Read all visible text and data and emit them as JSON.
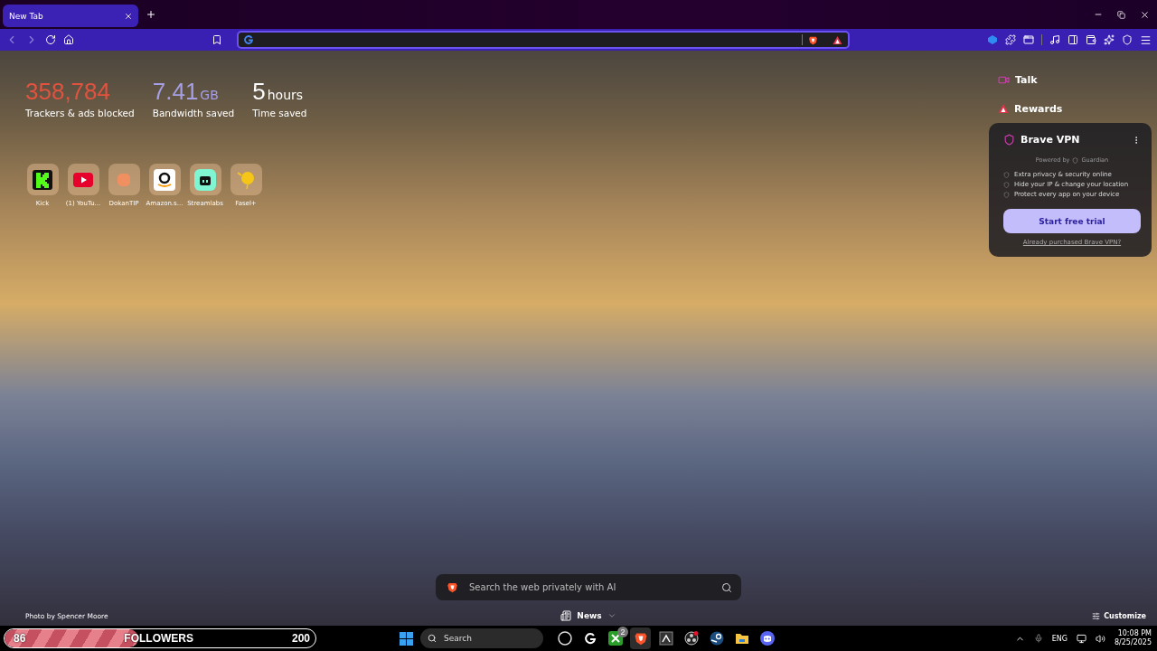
{
  "tabs": [
    {
      "title": "New Tab",
      "selected": true
    }
  ],
  "nav_buttons": [
    {
      "kind": "back",
      "disabled": true
    },
    {
      "kind": "forward",
      "disabled": true
    },
    {
      "kind": "reload",
      "disabled": false
    },
    {
      "kind": "home",
      "disabled": false
    }
  ],
  "stats": [
    {
      "value": "358,784",
      "label": "Trackers & ads blocked",
      "color": "#e2533f"
    },
    {
      "value": "7.41",
      "unit": "GB",
      "label": "Bandwidth saved",
      "color": "#a69fe6"
    },
    {
      "value": "5",
      "unit": "hours",
      "label": "Time saved",
      "color": "#ffffff"
    }
  ],
  "top_sites": [
    {
      "kind": "kick",
      "label": "Kick"
    },
    {
      "kind": "youtube",
      "label": "(1) YouTu..."
    },
    {
      "kind": "blob",
      "label": "DokanTIP"
    },
    {
      "kind": "amazon",
      "label": "Amazon.s..."
    },
    {
      "kind": "streamlabs",
      "label": "Streamlabs"
    },
    {
      "kind": "balloon",
      "label": "Fasel+"
    }
  ],
  "panel": {
    "items": [
      {
        "kind": "talk",
        "label": "Talk"
      },
      {
        "kind": "rewards",
        "label": "Rewards"
      }
    ],
    "vpn": {
      "title": "Brave VPN",
      "powered_by": "Powered by",
      "brand": "Guardian",
      "features": [
        "Extra privacy & security online",
        "Hide your IP & change your location",
        "Protect every app on your device"
      ],
      "button": "Start free trial",
      "link": "Already purchased Brave VPN?"
    }
  },
  "photo_credit": "Photo by Spencer Moore",
  "search": {
    "placeholder": "Search the web privately with AI"
  },
  "news": {
    "label": "News"
  },
  "customize": {
    "label": "Customize"
  },
  "followers": {
    "current": "86",
    "label": "FOLLOWERS",
    "goal": "200",
    "level": 0.43
  },
  "taskbar": {
    "search_placeholder": "Search",
    "apps": [
      {
        "kind": "circle",
        "selected": false
      },
      {
        "kind": "g",
        "selected": false
      },
      {
        "kind": "xbox",
        "selected": false,
        "badge": "2"
      },
      {
        "kind": "brave",
        "selected": true
      },
      {
        "kind": "square",
        "selected": false
      },
      {
        "kind": "obs",
        "selected": false
      },
      {
        "kind": "steam",
        "selected": false
      },
      {
        "kind": "folder",
        "selected": false
      },
      {
        "kind": "discord",
        "selected": false
      }
    ],
    "language": "ENG",
    "time": "10:08 PM",
    "date": "8/25/2025"
  }
}
